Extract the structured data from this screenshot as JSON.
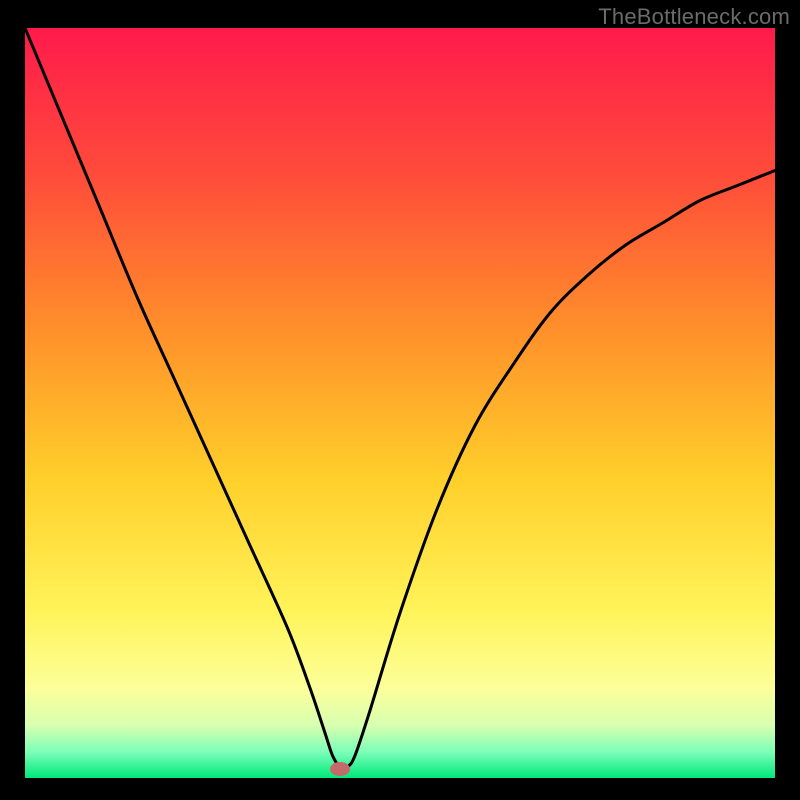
{
  "watermark": "TheBottleneck.com",
  "chart_data": {
    "type": "line",
    "title": "",
    "xlabel": "",
    "ylabel": "",
    "xlim": [
      0,
      100
    ],
    "ylim": [
      0,
      100
    ],
    "grid": false,
    "marker": {
      "x": 42,
      "y": 1.2
    },
    "series": [
      {
        "name": "curve",
        "x": [
          0,
          5,
          10,
          15,
          20,
          25,
          30,
          35,
          38,
          40,
          41,
          42,
          43,
          44,
          46,
          50,
          55,
          60,
          65,
          70,
          75,
          80,
          85,
          90,
          95,
          100
        ],
        "y": [
          100,
          88,
          76,
          64,
          53,
          42,
          31,
          20,
          12,
          6,
          3,
          1.5,
          1.5,
          3,
          9,
          22,
          36,
          47,
          55,
          62,
          67,
          71,
          74,
          77,
          79,
          81
        ]
      }
    ],
    "background_gradient": {
      "stops": [
        {
          "offset": 0.0,
          "color": "#ff1a4b"
        },
        {
          "offset": 0.2,
          "color": "#ff4d3a"
        },
        {
          "offset": 0.4,
          "color": "#ff8f2a"
        },
        {
          "offset": 0.6,
          "color": "#ffcf2a"
        },
        {
          "offset": 0.78,
          "color": "#fff45a"
        },
        {
          "offset": 0.88,
          "color": "#fcff9a"
        },
        {
          "offset": 0.93,
          "color": "#d8ffb0"
        },
        {
          "offset": 0.965,
          "color": "#7dffb8"
        },
        {
          "offset": 1.0,
          "color": "#00e87a"
        }
      ]
    }
  }
}
